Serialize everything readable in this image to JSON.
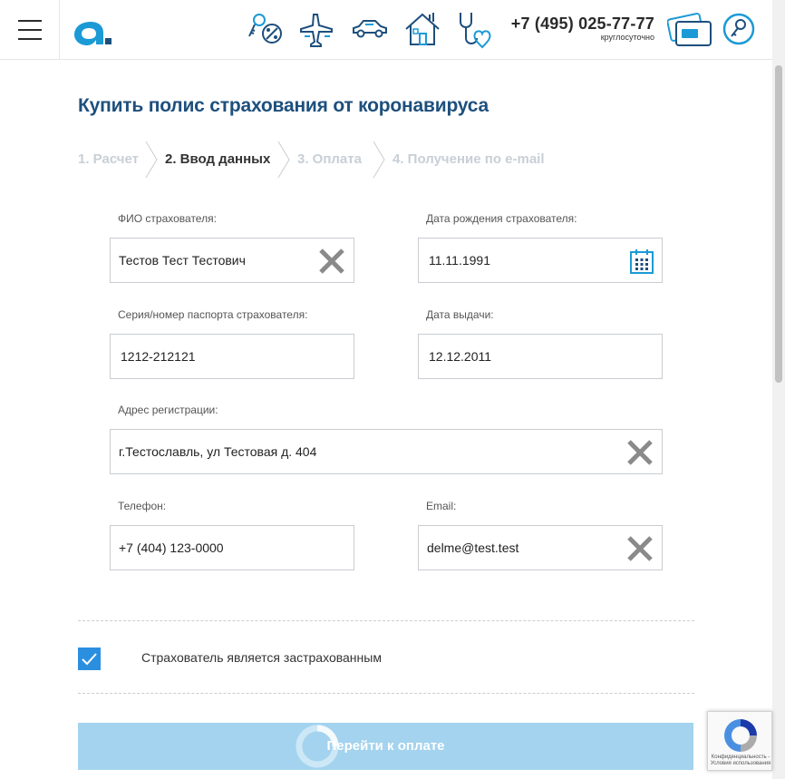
{
  "header": {
    "phone": "+7 (495) 025-77-77",
    "phone_note": "круглосуточно"
  },
  "page": {
    "title": "Купить полис страхования от коронавируса"
  },
  "steps": [
    {
      "label": "1. Расчет",
      "state": "inactive"
    },
    {
      "label": "2. Ввод данных",
      "state": "active"
    },
    {
      "label": "3. Оплата",
      "state": "inactive"
    },
    {
      "label": "4. Получение по e-mail",
      "state": "inactive"
    }
  ],
  "form": {
    "fio": {
      "label": "ФИО страхователя:",
      "value": "Тестов Тест Тестович"
    },
    "birthdate": {
      "label": "Дата рождения страхователя:",
      "value": "11.11.1991"
    },
    "passport": {
      "label": "Серия/номер паспорта страхователя:",
      "value": "1212-212121"
    },
    "issue_date": {
      "label": "Дата выдачи:",
      "value": "12.12.2011"
    },
    "address": {
      "label": "Адрес регистрации:",
      "value": "г.Тестославль, ул Тестовая д. 404"
    },
    "phone": {
      "label": "Телефон:",
      "value": "+7 (404) 123-0000"
    },
    "email": {
      "label": "Email:",
      "value": "delme@test.test"
    }
  },
  "checkbox": {
    "label": "Страхователь является застрахованным",
    "checked": true
  },
  "pay_button": {
    "label": "Перейти к оплате"
  },
  "recaptcha": {
    "text1": "Конфиденциальность -",
    "text2": "Условия использования"
  },
  "colors": {
    "brand": "#1d4f7d",
    "accent": "#2b8fe0",
    "icon": "#1b9ad6",
    "button": "#a3d3ee"
  }
}
